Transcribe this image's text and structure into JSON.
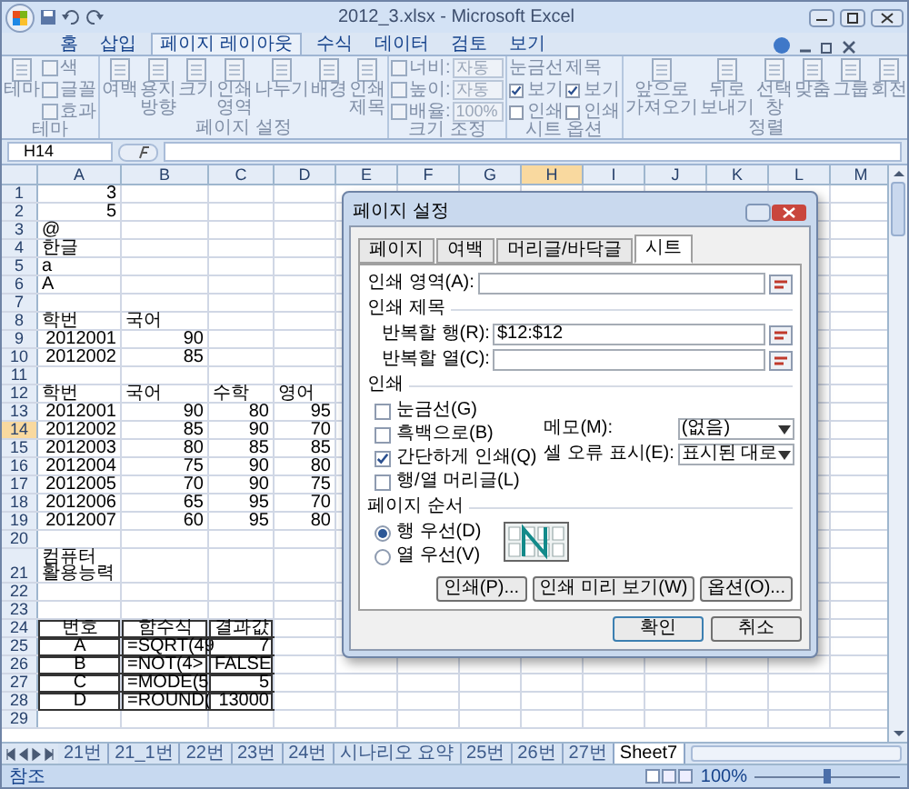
{
  "window": {
    "title": "2012_3.xlsx - Microsoft Excel"
  },
  "ribbon": {
    "tabs": [
      {
        "label": "홈",
        "selected": false
      },
      {
        "label": "삽입",
        "selected": false
      },
      {
        "label": "페이지 레이아웃",
        "selected": true
      },
      {
        "label": "수식",
        "selected": false
      },
      {
        "label": "데이터",
        "selected": false
      },
      {
        "label": "검토",
        "selected": false
      },
      {
        "label": "보기",
        "selected": false
      }
    ],
    "groups": [
      {
        "label": "테마",
        "items": [
          {
            "kind": "big",
            "label": "테마"
          },
          {
            "kind": "small",
            "label": "색"
          },
          {
            "kind": "small",
            "label": "글꼴"
          },
          {
            "kind": "small",
            "label": "효과"
          }
        ]
      },
      {
        "label": "페이지 설정",
        "items": [
          {
            "kind": "big",
            "label": "여백"
          },
          {
            "kind": "big",
            "label": "용지 방향"
          },
          {
            "kind": "big",
            "label": "크기"
          },
          {
            "kind": "big",
            "label": "인쇄 영역"
          },
          {
            "kind": "big",
            "label": "나누기"
          },
          {
            "kind": "big",
            "label": "배경"
          },
          {
            "kind": "big",
            "label": "인쇄 제목"
          }
        ]
      },
      {
        "label": "크기 조정",
        "items": [
          {
            "kind": "select",
            "label": "너비:",
            "value": "자동"
          },
          {
            "kind": "select",
            "label": "높이:",
            "value": "자동"
          },
          {
            "kind": "spin",
            "label": "배율:",
            "value": "100%"
          }
        ]
      },
      {
        "label": "시트 옵션",
        "items": [
          {
            "kind": "options",
            "label": "눈금선",
            "checks": [
              {
                "label": "보기",
                "checked": true
              },
              {
                "label": "인쇄",
                "checked": false
              }
            ]
          },
          {
            "kind": "options",
            "label": "제목",
            "checks": [
              {
                "label": "보기",
                "checked": true
              },
              {
                "label": "인쇄",
                "checked": false
              }
            ]
          }
        ]
      },
      {
        "label": "정렬",
        "items": [
          {
            "kind": "big",
            "label": "앞으로 가져오기"
          },
          {
            "kind": "big",
            "label": "뒤로 보내기"
          },
          {
            "kind": "big",
            "label": "선택 창"
          },
          {
            "kind": "big",
            "label": "맞춤"
          },
          {
            "kind": "big",
            "label": "그룹"
          },
          {
            "kind": "big",
            "label": "회전"
          }
        ]
      }
    ]
  },
  "formula_bar": {
    "name_box": "H14"
  },
  "sheet": {
    "columns": [
      {
        "label": "A",
        "selected": false
      },
      {
        "label": "B",
        "selected": false
      },
      {
        "label": "C",
        "selected": false
      },
      {
        "label": "D",
        "selected": false
      },
      {
        "label": "E",
        "selected": false
      },
      {
        "label": "F",
        "selected": false
      },
      {
        "label": "G",
        "selected": false
      },
      {
        "label": "H",
        "selected": true
      },
      {
        "label": "I",
        "selected": false
      },
      {
        "label": "J",
        "selected": false
      },
      {
        "label": "K",
        "selected": false
      },
      {
        "label": "L",
        "selected": false
      },
      {
        "label": "M",
        "selected": false
      }
    ],
    "rows": [
      {
        "header": "1",
        "selected": false,
        "cells": [
          {
            "text": "3",
            "kind": "number"
          }
        ]
      },
      {
        "header": "2",
        "selected": false,
        "cells": [
          {
            "text": "5",
            "kind": "number"
          }
        ]
      },
      {
        "header": "3",
        "selected": false,
        "cells": [
          {
            "text": "@",
            "kind": "text"
          }
        ]
      },
      {
        "header": "4",
        "selected": false,
        "cells": [
          {
            "text": "한글",
            "kind": "text"
          }
        ]
      },
      {
        "header": "5",
        "selected": false,
        "cells": [
          {
            "text": "a",
            "kind": "text"
          }
        ]
      },
      {
        "header": "6",
        "selected": false,
        "cells": [
          {
            "text": "A",
            "kind": "text"
          }
        ]
      },
      {
        "header": "7",
        "selected": false
      },
      {
        "header": "8",
        "selected": false,
        "cells": [
          {
            "text": "학번",
            "kind": "text"
          },
          {
            "text": "국어",
            "kind": "text"
          }
        ]
      },
      {
        "header": "9",
        "selected": false,
        "cells": [
          {
            "text": "2012001",
            "kind": "number"
          },
          {
            "text": "90",
            "kind": "number"
          }
        ]
      },
      {
        "header": "10",
        "selected": false,
        "cells": [
          {
            "text": "2012002",
            "kind": "number"
          },
          {
            "text": "85",
            "kind": "number"
          }
        ]
      },
      {
        "header": "11",
        "selected": false
      },
      {
        "header": "12",
        "selected": false,
        "cells": [
          {
            "text": "학번",
            "kind": "text"
          },
          {
            "text": "국어",
            "kind": "text"
          },
          {
            "text": "수학",
            "kind": "text"
          },
          {
            "text": "영어",
            "kind": "text"
          }
        ]
      },
      {
        "header": "13",
        "selected": false,
        "cells": [
          {
            "text": "2012001",
            "kind": "number"
          },
          {
            "text": "90",
            "kind": "number"
          },
          {
            "text": "80",
            "kind": "number"
          },
          {
            "text": "95",
            "kind": "number"
          }
        ]
      },
      {
        "header": "14",
        "selected": true,
        "cells": [
          {
            "text": "2012002",
            "kind": "number"
          },
          {
            "text": "85",
            "kind": "number"
          },
          {
            "text": "90",
            "kind": "number"
          },
          {
            "text": "70",
            "kind": "number"
          }
        ]
      },
      {
        "header": "15",
        "selected": false,
        "cells": [
          {
            "text": "2012003",
            "kind": "number"
          },
          {
            "text": "80",
            "kind": "number"
          },
          {
            "text": "85",
            "kind": "number"
          },
          {
            "text": "85",
            "kind": "number"
          }
        ]
      },
      {
        "header": "16",
        "selected": false,
        "cells": [
          {
            "text": "2012004",
            "kind": "number"
          },
          {
            "text": "75",
            "kind": "number"
          },
          {
            "text": "90",
            "kind": "number"
          },
          {
            "text": "80",
            "kind": "number"
          }
        ]
      },
      {
        "header": "17",
        "selected": false,
        "cells": [
          {
            "text": "2012005",
            "kind": "number"
          },
          {
            "text": "70",
            "kind": "number"
          },
          {
            "text": "90",
            "kind": "number"
          },
          {
            "text": "75",
            "kind": "number"
          }
        ]
      },
      {
        "header": "18",
        "selected": false,
        "cells": [
          {
            "text": "2012006",
            "kind": "number"
          },
          {
            "text": "65",
            "kind": "number"
          },
          {
            "text": "95",
            "kind": "number"
          },
          {
            "text": "70",
            "kind": "number"
          }
        ]
      },
      {
        "header": "19",
        "selected": false,
        "cells": [
          {
            "text": "2012007",
            "kind": "number"
          },
          {
            "text": "60",
            "kind": "number"
          },
          {
            "text": "95",
            "kind": "number"
          },
          {
            "text": "80",
            "kind": "number"
          }
        ]
      },
      {
        "header": "20",
        "selected": false
      },
      {
        "header": "21",
        "selected": false,
        "cells": [
          {
            "text": "컴퓨터 활용능력",
            "kind": "text"
          }
        ]
      },
      {
        "header": "22",
        "selected": false
      },
      {
        "header": "23",
        "selected": false
      },
      {
        "header": "24",
        "selected": false,
        "cells": [
          {
            "text": "번호",
            "kind": "boxed-center"
          },
          {
            "text": "함수식",
            "kind": "boxed-center"
          },
          {
            "text": "결과값",
            "kind": "boxed-center"
          }
        ]
      },
      {
        "header": "25",
        "selected": false,
        "cells": [
          {
            "text": "A",
            "kind": "boxed-center"
          },
          {
            "text": "=SQRT(49",
            "kind": "boxed-text"
          },
          {
            "text": "7",
            "kind": "boxed-number"
          }
        ]
      },
      {
        "header": "26",
        "selected": false,
        "cells": [
          {
            "text": "B",
            "kind": "boxed-center"
          },
          {
            "text": "=NOT(4>",
            "kind": "boxed-text"
          },
          {
            "text": "FALSE",
            "kind": "boxed-number"
          }
        ]
      },
      {
        "header": "27",
        "selected": false,
        "cells": [
          {
            "text": "C",
            "kind": "boxed-center"
          },
          {
            "text": "=MODE(5",
            "kind": "boxed-text"
          },
          {
            "text": "5",
            "kind": "boxed-number"
          }
        ]
      },
      {
        "header": "28",
        "selected": false,
        "cells": [
          {
            "text": "D",
            "kind": "boxed-center"
          },
          {
            "text": "=ROUND(",
            "kind": "boxed-text"
          },
          {
            "text": "13000",
            "kind": "boxed-number"
          }
        ]
      },
      {
        "header": "29",
        "selected": false
      }
    ]
  },
  "sheet_tabs": [
    {
      "label": "21번",
      "selected": false
    },
    {
      "label": "21_1번",
      "selected": false
    },
    {
      "label": "22번",
      "selected": false
    },
    {
      "label": "23번",
      "selected": false
    },
    {
      "label": "24번",
      "selected": false
    },
    {
      "label": "시나리오 요약",
      "selected": false
    },
    {
      "label": "25번",
      "selected": false
    },
    {
      "label": "26번",
      "selected": false
    },
    {
      "label": "27번",
      "selected": false
    },
    {
      "label": "Sheet7",
      "selected": true
    }
  ],
  "status_bar": {
    "text": "참조",
    "zoom": {
      "label": "100%",
      "level": 0.5
    }
  },
  "dialog": {
    "title": "페이지 설정",
    "tabs": [
      {
        "label": "페이지",
        "selected": false
      },
      {
        "label": "여백",
        "selected": false
      },
      {
        "label": "머리글/바닥글",
        "selected": false
      },
      {
        "label": "시트",
        "selected": true
      }
    ],
    "print_area": {
      "label": "인쇄 영역(A):"
    },
    "print_titles": {
      "label": "인쇄 제목",
      "fields": [
        {
          "label": "반복할 행(R):",
          "value": "$12:$12"
        },
        {
          "label": "반복할 열(C):"
        }
      ]
    },
    "print": {
      "label": "인쇄",
      "checks": [
        {
          "label": "눈금선(G)",
          "checked": false
        },
        {
          "label": "흑백으로(B)",
          "checked": false
        },
        {
          "label": "간단하게 인쇄(Q)",
          "checked": true
        },
        {
          "label": "행/열 머리글(L)",
          "checked": false
        }
      ],
      "selects": [
        {
          "label": "메모(M):",
          "value": "(없음)"
        },
        {
          "label": "셀 오류 표시(E):",
          "value": "표시된 대로"
        }
      ]
    },
    "page_order": {
      "label": "페이지 순서",
      "options": [
        {
          "label": "행 우선(D)",
          "selected": true
        },
        {
          "label": "열 우선(V)",
          "selected": false
        }
      ]
    },
    "buttons": [
      "인쇄(P)...",
      "인쇄 미리 보기(W)",
      "옵션(O)..."
    ],
    "footer_buttons": [
      "확인",
      "취소"
    ]
  }
}
